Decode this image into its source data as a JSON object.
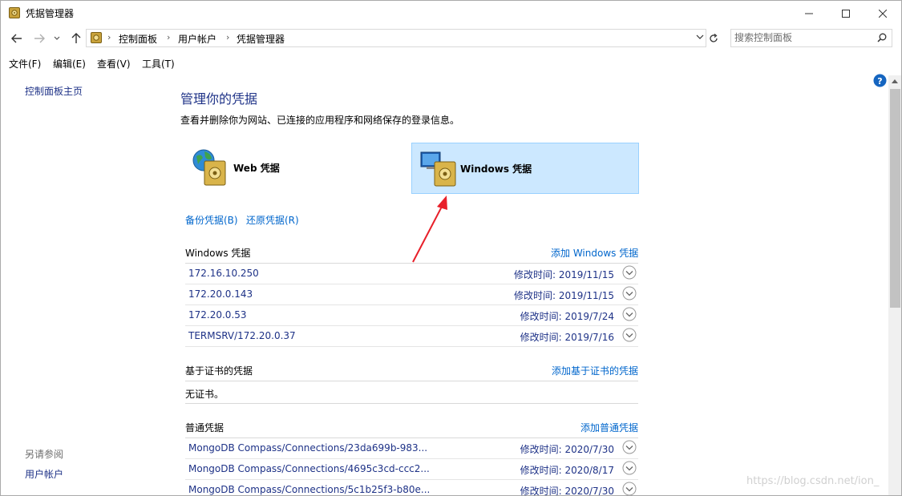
{
  "window": {
    "title": "凭据管理器"
  },
  "address": {
    "crumbs": [
      "控制面板",
      "用户帐户",
      "凭据管理器"
    ],
    "search_placeholder": "搜索控制面板"
  },
  "menu": [
    "文件(F)",
    "编辑(E)",
    "查看(V)",
    "工具(T)"
  ],
  "left_nav": {
    "home_link": "控制面板主页",
    "see_also_label": "另请参阅",
    "see_also_links": [
      "用户帐户"
    ]
  },
  "main": {
    "heading": "管理你的凭据",
    "description": "查看并删除你为网站、已连接的应用程序和网络保存的登录信息。",
    "credential_types": [
      {
        "label": "Web 凭据",
        "selected": false
      },
      {
        "label": "Windows 凭据",
        "selected": true
      }
    ],
    "backup_link": "备份凭据(B)",
    "restore_link": "还原凭据(R)",
    "windows_section": {
      "title": "Windows 凭据",
      "action": "添加 Windows 凭据",
      "items": [
        {
          "name": "172.16.10.250",
          "modified_label": "修改时间:",
          "modified": "2019/11/15"
        },
        {
          "name": "172.20.0.143",
          "modified_label": "修改时间:",
          "modified": "2019/11/15"
        },
        {
          "name": "172.20.0.53",
          "modified_label": "修改时间:",
          "modified": "2019/7/24"
        },
        {
          "name": "TERMSRV/172.20.0.37",
          "modified_label": "修改时间:",
          "modified": "2019/7/16"
        }
      ]
    },
    "cert_section": {
      "title": "基于证书的凭据",
      "action": "添加基于证书的凭据",
      "empty_text": "无证书。"
    },
    "generic_section": {
      "title": "普通凭据",
      "action": "添加普通凭据",
      "items": [
        {
          "name": "MongoDB Compass/Connections/23da699b-983...",
          "modified_label": "修改时间:",
          "modified": "2020/7/30"
        },
        {
          "name": "MongoDB Compass/Connections/4695c3cd-ccc2...",
          "modified_label": "修改时间:",
          "modified": "2020/8/17"
        },
        {
          "name": "MongoDB Compass/Connections/5c1b25f3-b80e...",
          "modified_label": "修改时间:",
          "modified": "2020/7/30"
        }
      ]
    }
  },
  "watermark": "https://blog.csdn.net/ion_",
  "colors": {
    "link": "#1e3287",
    "action_link": "#0066cc",
    "selected_bg": "#cce8ff",
    "annotation_arrow": "#e8202a"
  }
}
